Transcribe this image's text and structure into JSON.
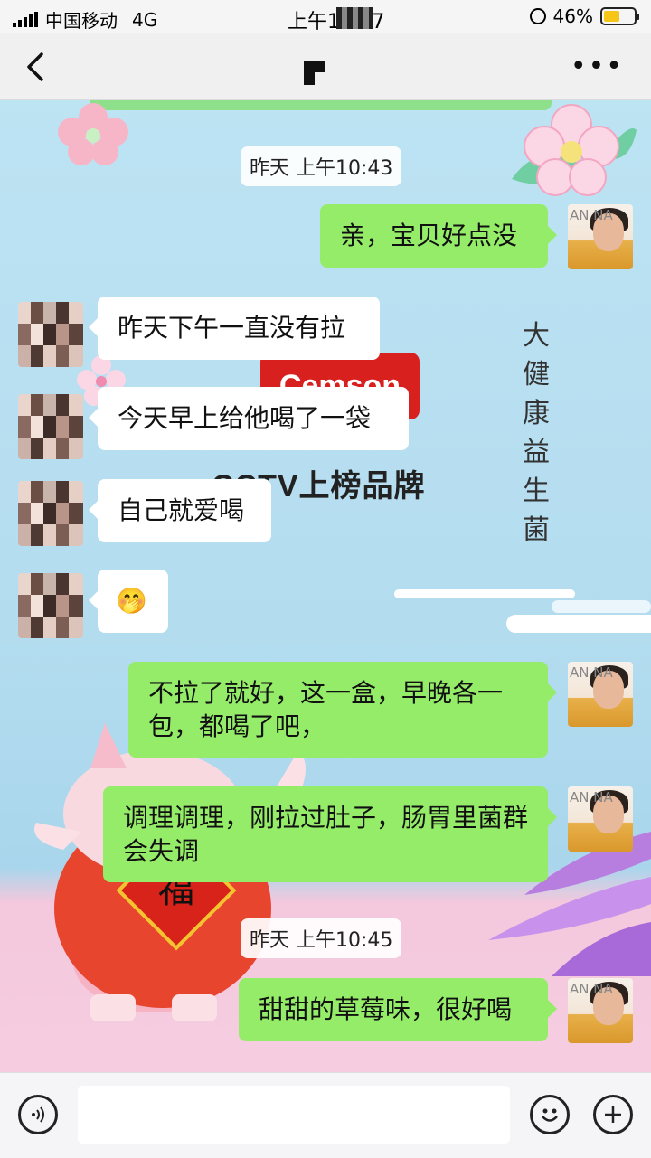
{
  "status_bar": {
    "carrier": "中国移动",
    "network": "4G",
    "time": "上午10:07",
    "battery": "46%",
    "battery_level": 0.46
  },
  "nav": {
    "back_icon": "chevron-left-icon",
    "more_icon": "more-dots-icon"
  },
  "background": {
    "brand_logo": "Cemson",
    "cctv_text": "CCTV上榜品牌",
    "vertical_text": [
      "大",
      "健",
      "康",
      "益",
      "生",
      "菌"
    ],
    "pig_badge": "福"
  },
  "chat": {
    "timestamps": [
      "昨天 上午10:43",
      "昨天 上午10:45"
    ],
    "messages": [
      {
        "side": "me",
        "text": "亲，宝贝好点没"
      },
      {
        "side": "them",
        "text": "昨天下午一直没有拉"
      },
      {
        "side": "them",
        "text": "今天早上给他喝了一袋"
      },
      {
        "side": "them",
        "text": "自己就爱喝"
      },
      {
        "side": "them",
        "text": "🤭"
      },
      {
        "side": "me",
        "text": "不拉了就好，这一盒，早晚各一包，都喝了吧，"
      },
      {
        "side": "me",
        "text": "调理调理，刚拉过肚子，肠胃里菌群会失调"
      },
      {
        "side": "me",
        "text": "甜甜的草莓味，很好喝"
      }
    ],
    "my_avatar_label": "AN NA"
  },
  "input_bar": {
    "voice_icon": "voice-icon",
    "emoji_icon": "emoji-icon",
    "add_icon": "plus-icon",
    "placeholder": ""
  }
}
